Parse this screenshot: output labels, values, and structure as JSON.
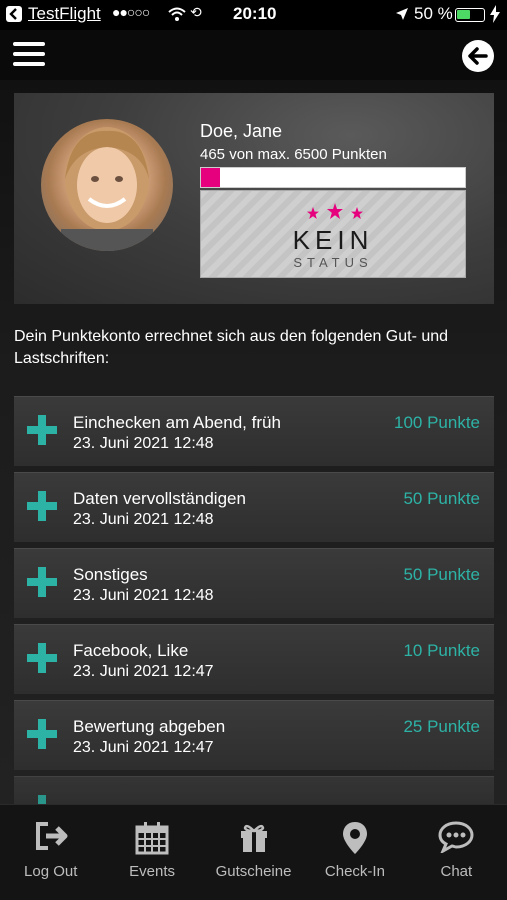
{
  "statusbar": {
    "app": "TestFlight",
    "signal": "●●○○○",
    "time": "20:10",
    "battery": "50 %",
    "battery_level": 0.5
  },
  "profile": {
    "name": "Doe, Jane",
    "points_text": "465  von max. 6500 Punkten",
    "points": 465,
    "max_points": 6500,
    "progress_color": "#e6007e",
    "status_line1": "KEIN",
    "status_line2": "STATUS"
  },
  "intro": "Dein Punktekonto errechnet sich aus den folgenden Gut- und Lastschriften:",
  "transactions": [
    {
      "title": "Einchecken am Abend, früh",
      "date": "23. Juni 2021 12:48",
      "points": "100 Punkte"
    },
    {
      "title": "Daten vervollständigen",
      "date": "23. Juni 2021 12:48",
      "points": "50 Punkte"
    },
    {
      "title": "Sonstiges",
      "date": "23. Juni 2021 12:48",
      "points": "50 Punkte"
    },
    {
      "title": "Facebook, Like",
      "date": "23. Juni 2021 12:47",
      "points": "10 Punkte"
    },
    {
      "title": "Bewertung abgeben",
      "date": "23. Juni 2021 12:47",
      "points": "25 Punkte"
    }
  ],
  "tabs": [
    {
      "label": "Log Out",
      "icon": "logout-icon"
    },
    {
      "label": "Events",
      "icon": "calendar-icon"
    },
    {
      "label": "Gutscheine",
      "icon": "gift-icon"
    },
    {
      "label": "Check-In",
      "icon": "location-pin-icon"
    },
    {
      "label": "Chat",
      "icon": "chat-bubble-icon"
    }
  ],
  "colors": {
    "accent": "#2db3a6",
    "brand_pink": "#e6007e",
    "background": "#1a1a1a"
  }
}
